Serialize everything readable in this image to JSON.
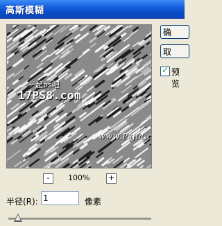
{
  "window": {
    "title": "高斯模糊"
  },
  "buttons": {
    "ok_label": "确",
    "reset_label": "取"
  },
  "preview_toggle": {
    "label": "预览",
    "checked": true
  },
  "watermarks": {
    "line1": "一起ps吧",
    "line2": "17PS8.com",
    "line3": "www.Psjia.com"
  },
  "zoom": {
    "minus": "-",
    "value": "100%",
    "plus": "+"
  },
  "radius": {
    "label": "半径(R):",
    "value": "1",
    "unit": "像素",
    "slider_fraction": 0.02
  }
}
